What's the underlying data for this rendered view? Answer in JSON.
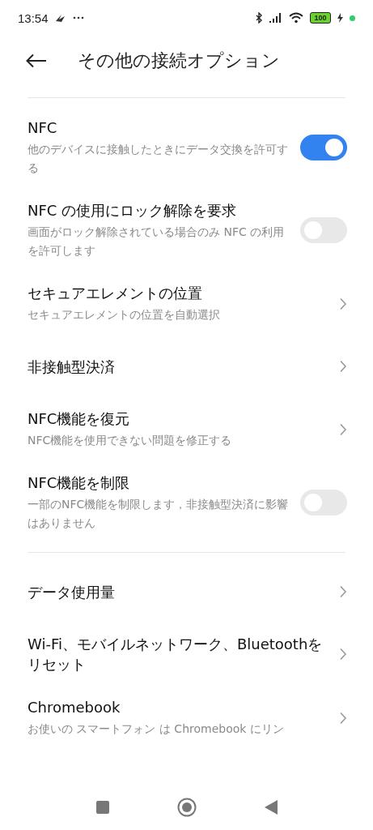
{
  "status_bar": {
    "time": "13:54",
    "battery": "100"
  },
  "header": {
    "title": "その他の接続オプション"
  },
  "sections": [
    {
      "items": [
        {
          "kind": "toggle",
          "title": "NFC",
          "subtitle": "他のデバイスに接触したときにデータ交換を許可する",
          "on": true
        },
        {
          "kind": "toggle",
          "title": "NFC の使用にロック解除を要求",
          "subtitle": "画面がロック解除されている場合のみ NFC の利用を許可します",
          "on": false
        },
        {
          "kind": "link",
          "title": "セキュアエレメントの位置",
          "subtitle": "セキュアエレメントの位置を自動選択"
        },
        {
          "kind": "link",
          "title": "非接触型決済"
        },
        {
          "kind": "link",
          "title": "NFC機能を復元",
          "subtitle": "NFC機能を使用できない問題を修正する"
        },
        {
          "kind": "toggle",
          "title": "NFC機能を制限",
          "subtitle": "一部のNFC機能を制限します，非接触型決済に影響はありません",
          "on": false
        }
      ]
    },
    {
      "items": [
        {
          "kind": "link",
          "title": "データ使用量"
        },
        {
          "kind": "link",
          "title": "Wi-Fi、モバイルネットワーク、Bluetoothをリセット"
        },
        {
          "kind": "link",
          "title": "Chromebook",
          "subtitle": "お使いの スマートフォン は Chromebook にリン"
        }
      ]
    }
  ]
}
